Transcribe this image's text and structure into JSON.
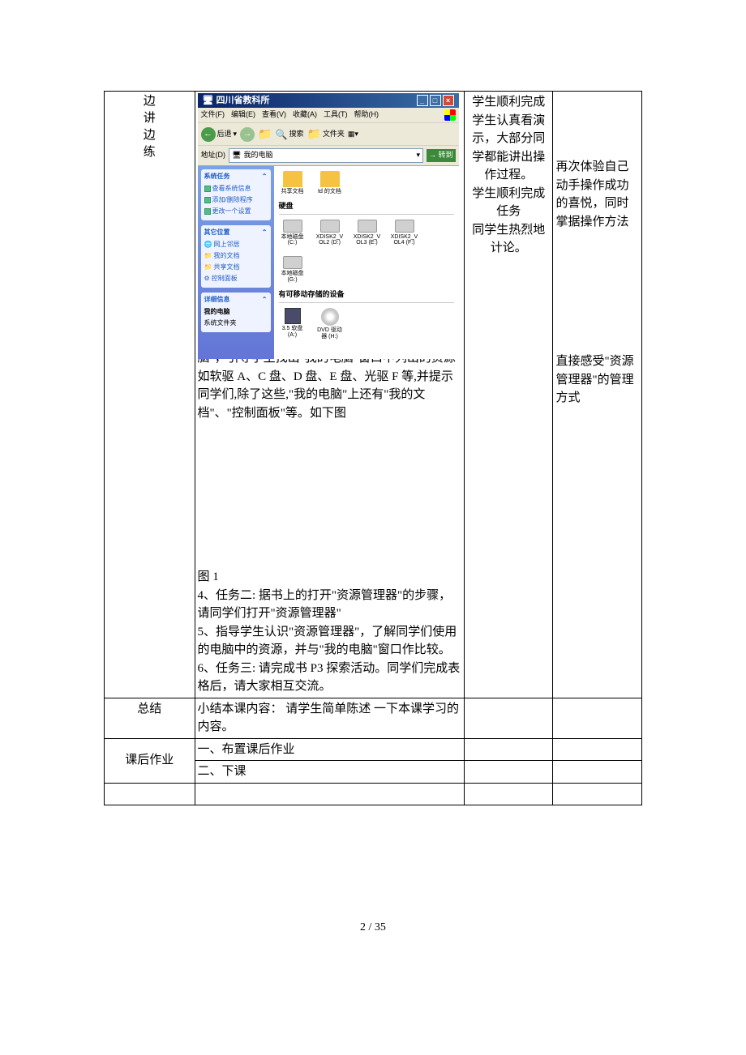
{
  "rows": {
    "r1_label": "边\n讲\n边\n练",
    "r1_col3": "学生顺利完成学生认真看演示，大部分同学都能讲出操作过程。\n学生顺利完成任务\n同学生热烈地计论。",
    "r1_col4a": "再次体验自己动手操作成功的喜悦，同时掌据操作方法",
    "r1_col4b": "直接感受\"资源管理器\"的管理方式",
    "r1_text_below": "脑\"，引导学生找出\"我的电脑\"窗口中列出的资源 如软驱 A、C 盘、D 盘、E 盘、光驱 F 等,并提示同学们,除了这些,\"我的电脑\"上还有\"我的文档\"、\"控制面板\"等。如下图",
    "r1_fig": "图 1",
    "r1_task2": "4、任务二: 据书上的打开\"资源管理器\"的步骤，请同学们打开\"资源管理器\"",
    "r1_task2b": "5、指导学生认识\"资源管理器\"，了解同学们使用的电脑中的资源，并与\"我的电脑\"窗口作比较。",
    "r1_task3": "6、任务三: 请完成书 P3 探索活动。同学们完成表格后，请大家相互交流。",
    "r2_label": "总结",
    "r2_col2": "小结本课内容： 请学生简单陈述 一下本课学习的内容。",
    "r3_label": "课后作业",
    "r3_col2": "一、布置课后作业",
    "r4_col2": "二、下课"
  },
  "win": {
    "title_prefix": "我的电脑",
    "title": "四川省教科所",
    "menu": [
      "文件(F)",
      "编辑(E)",
      "查看(V)",
      "收藏(A)",
      "工具(T)",
      "帮助(H)"
    ],
    "back": "后退",
    "search": "搜索",
    "folders": "文件夹",
    "addr_label": "地址(D)",
    "addr_val": "我的电脑",
    "go": "转到",
    "panel1": {
      "head": "系统任务",
      "items": [
        "查看系统信息",
        "添加/删除程序",
        "更改一个设置"
      ]
    },
    "panel2": {
      "head": "其它位置",
      "items": [
        "网上邻居",
        "我的文档",
        "共享文档",
        "控制面板"
      ]
    },
    "panel3": {
      "head": "详细信息",
      "items": [
        "我的电脑",
        "系统文件夹"
      ]
    },
    "folders_items": [
      {
        "name": "共享文档"
      },
      {
        "name": "td 的文档"
      }
    ],
    "section_drives": "硬盘",
    "drives": [
      {
        "name": "本地磁盘 (C:)"
      },
      {
        "name": "XDISK2_VOL2 (D:)"
      },
      {
        "name": "XDISK2_VOL3 (E:)"
      },
      {
        "name": "XDISK2_VOL4 (F:)"
      },
      {
        "name": "本地磁盘 (G:)"
      }
    ],
    "section_removable": "有可移动存储的设备",
    "removable": [
      {
        "name": "3.5 软盘 (A:)",
        "type": "floppy"
      },
      {
        "name": "DVD 驱动器 (H:)",
        "type": "dvd"
      }
    ]
  },
  "footer": "2 / 35"
}
